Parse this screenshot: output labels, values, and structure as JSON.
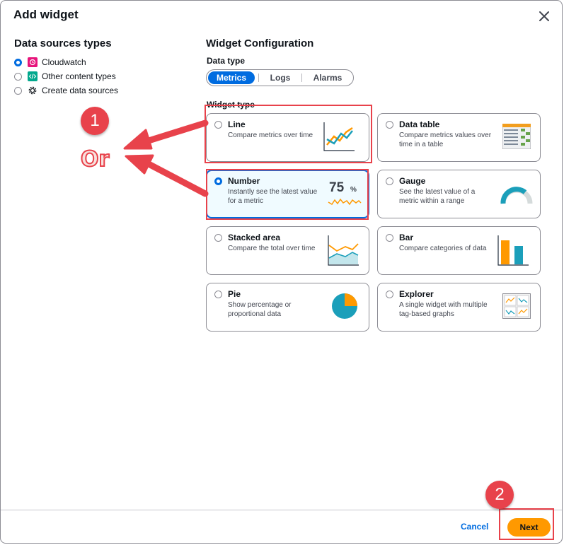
{
  "dialog": {
    "title": "Add widget"
  },
  "sources": {
    "heading": "Data sources types",
    "items": [
      {
        "label": "Cloudwatch",
        "icon": "cloudwatch-icon",
        "selected": true
      },
      {
        "label": "Other content types",
        "icon": "code-icon",
        "selected": false
      },
      {
        "label": "Create data sources",
        "icon": "gear-icon",
        "selected": false
      }
    ]
  },
  "config": {
    "heading": "Widget Configuration",
    "data_type_label": "Data type",
    "data_types": [
      "Metrics",
      "Logs",
      "Alarms"
    ],
    "selected_data_type": "Metrics",
    "widget_type_label": "Widget type",
    "widgets": [
      {
        "title": "Line",
        "desc": "Compare metrics over time",
        "icon": "line-chart-icon",
        "selected": false
      },
      {
        "title": "Data table",
        "desc": "Compare metrics values over time in a table",
        "icon": "table-icon",
        "selected": false
      },
      {
        "title": "Number",
        "desc": "Instantly see the latest value for a metric",
        "icon": "number-icon",
        "selected": true,
        "value": "75",
        "unit": "%"
      },
      {
        "title": "Gauge",
        "desc": "See the latest value of a metric within a range",
        "icon": "gauge-icon",
        "selected": false
      },
      {
        "title": "Stacked area",
        "desc": "Compare the total over time",
        "icon": "stacked-area-icon",
        "selected": false
      },
      {
        "title": "Bar",
        "desc": "Compare categories of data",
        "icon": "bar-chart-icon",
        "selected": false
      },
      {
        "title": "Pie",
        "desc": "Show percentage or proportional data",
        "icon": "pie-chart-icon",
        "selected": false
      },
      {
        "title": "Explorer",
        "desc": "A single widget with multiple tag-based graphs",
        "icon": "explorer-icon",
        "selected": false
      }
    ]
  },
  "footer": {
    "cancel": "Cancel",
    "next": "Next"
  },
  "annotations": {
    "step1": "1",
    "step2": "2",
    "or": "Or"
  },
  "colors": {
    "accent": "#006ce0",
    "primary_button": "#ff9900",
    "annotation": "#e8424b"
  }
}
